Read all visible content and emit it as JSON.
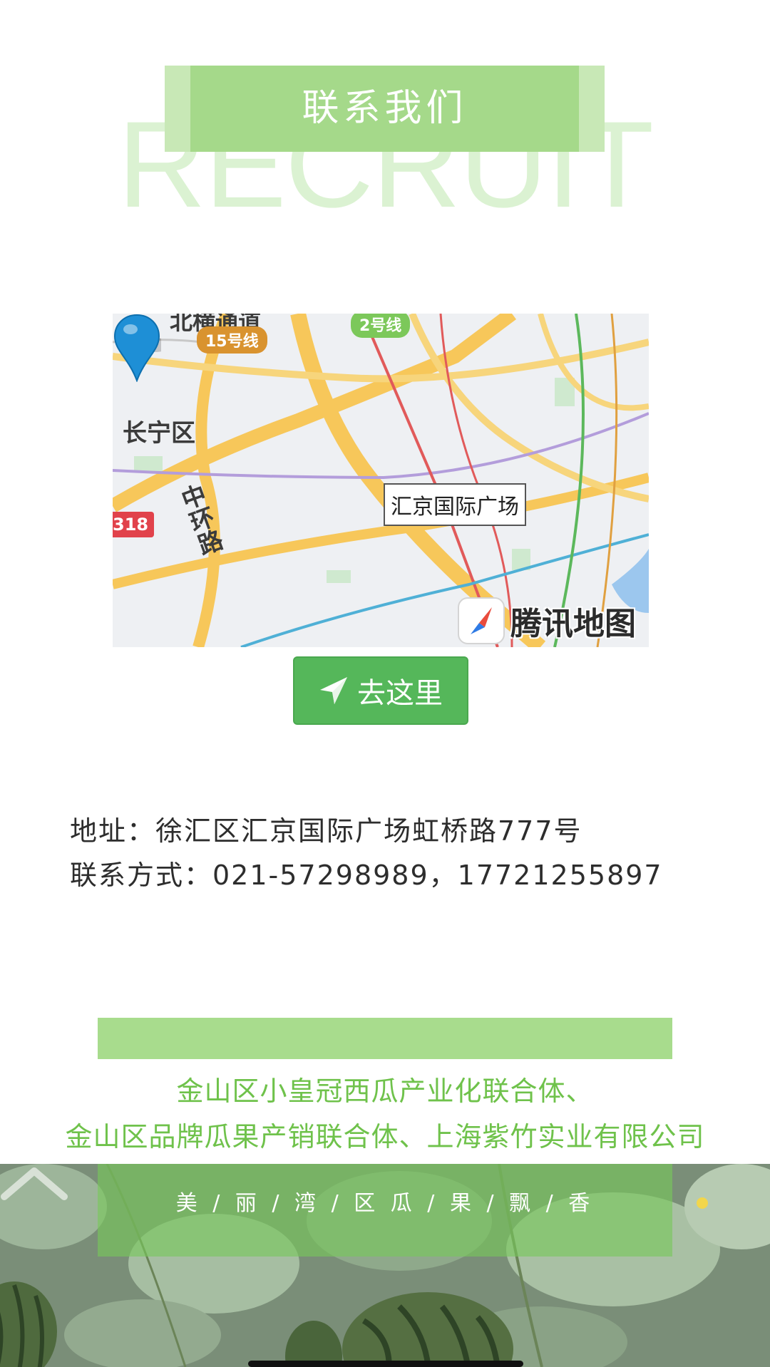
{
  "header": {
    "title": "联系我们",
    "background_text": "RECRUIT"
  },
  "map": {
    "district_label": "长宁区",
    "road_label": "中环路",
    "top_road_label": "北横通道",
    "line_15_label": "15号线",
    "line_2_label": "2号线",
    "highway_label": "318",
    "place_label": "汇京国际广场",
    "brand": "腾讯地图",
    "pin_icon": "map-pin-icon",
    "compass_icon": "compass-icon"
  },
  "go_button": {
    "label": "去这里",
    "icon": "send-arrow-icon",
    "color": "#55b75a"
  },
  "contact": {
    "address": "地址：徐汇区汇京国际广场虹桥路777号",
    "phone": "联系方式：021-57298989，17721255897"
  },
  "footer": {
    "company_line_1": "金山区小皇冠西瓜产业化联合体、",
    "company_line_2": "金山区品牌瓜果产销联合体、上海紫竹实业有限公司",
    "slogan": "美 / 丽 / 湾 / 区   瓜 / 果 / 飘 / 香",
    "back_to_top_icon": "chevron-up-icon",
    "accent_color": "#6fc24b"
  }
}
